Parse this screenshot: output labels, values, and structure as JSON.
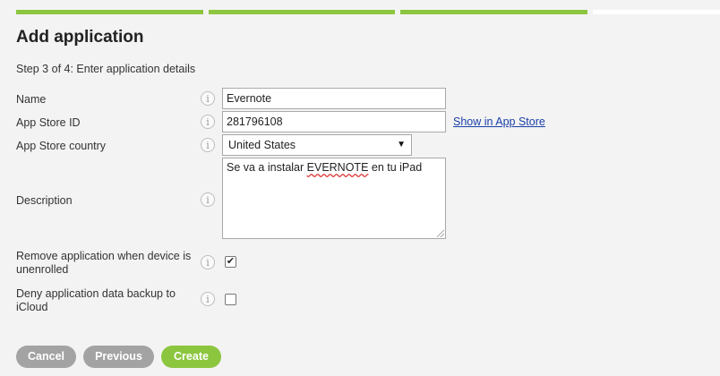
{
  "colors": {
    "progress_done": "#8cc63f",
    "progress_todo": "#ffffff",
    "button_gray": "#a3a3a3",
    "button_green": "#8cc63f"
  },
  "header": {
    "title": "Add application",
    "step_text": "Step 3 of 4: Enter application details"
  },
  "progress": {
    "current_step": 3,
    "total_steps": 4
  },
  "info_glyph": "i",
  "form": {
    "name": {
      "label": "Name",
      "value": "Evernote"
    },
    "app_store_id": {
      "label": "App Store ID",
      "value": "281796108",
      "link": "Show in App Store"
    },
    "country": {
      "label": "App Store country",
      "selected": "United States",
      "arrow": "▼"
    },
    "description": {
      "label": "Description",
      "value_before": "Se va a instalar ",
      "value_flagged": "EVERNOTE",
      "value_after": " en tu iPad"
    },
    "remove_on_unenroll": {
      "label_line1": "Remove application when device is",
      "label_line2": "unenrolled",
      "checked": true,
      "check_glyph": "✔"
    },
    "deny_backup": {
      "label_line1": "Deny application data backup to",
      "label_line2": "iCloud",
      "checked": false
    }
  },
  "buttons": {
    "cancel": "Cancel",
    "previous": "Previous",
    "create": "Create"
  }
}
